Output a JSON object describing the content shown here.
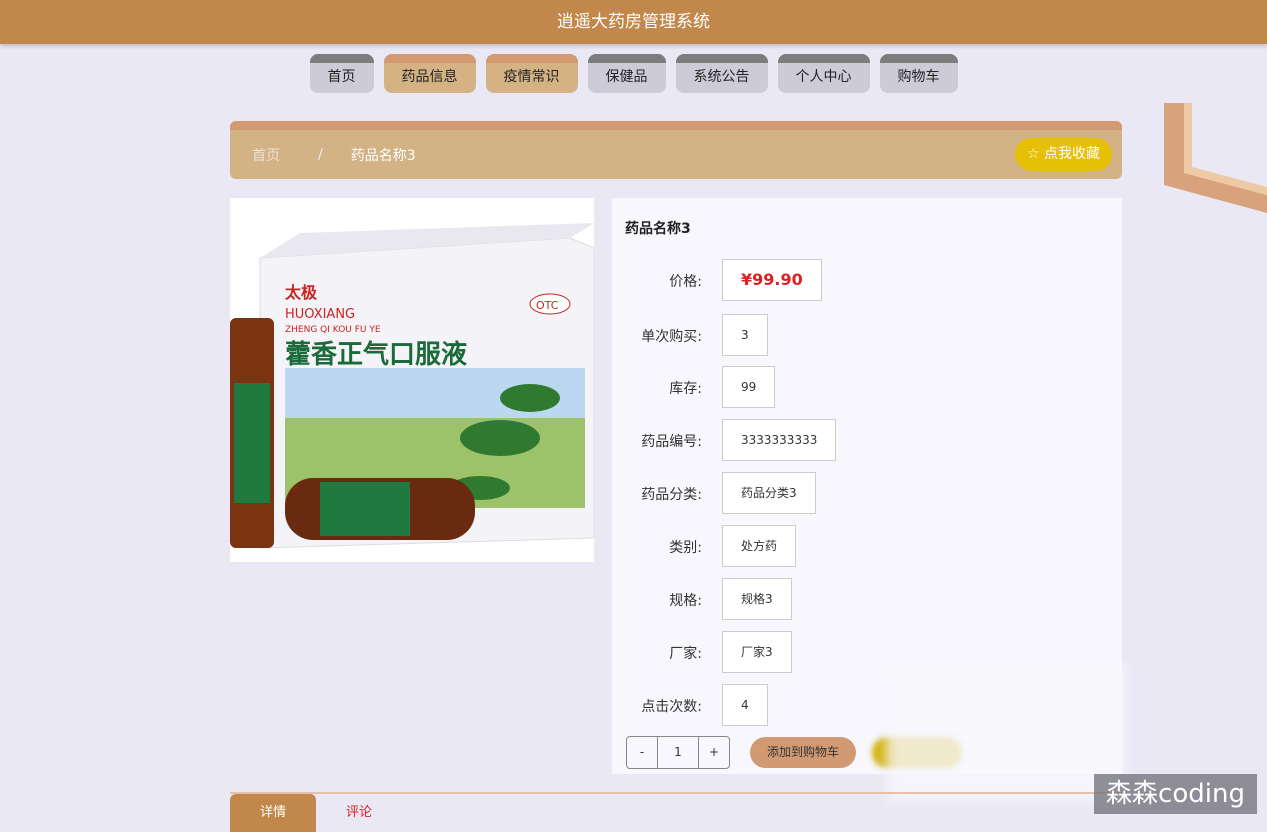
{
  "header": {
    "title": "逍遥大药房管理系统"
  },
  "nav": [
    {
      "label": "首页",
      "active": false
    },
    {
      "label": "药品信息",
      "active": true
    },
    {
      "label": "疫情常识",
      "active": true
    },
    {
      "label": "保健品",
      "active": false
    },
    {
      "label": "系统公告",
      "active": false
    },
    {
      "label": "个人中心",
      "active": false
    },
    {
      "label": "购物车",
      "active": false
    }
  ],
  "breadcrumb": {
    "home": "首页",
    "sep": "/",
    "current": "药品名称3"
  },
  "favorite_label": "☆ 点我收藏",
  "product_image": {
    "brand": "太极",
    "pinyin": "HUOXIANG",
    "pinyin2": "ZHENG QI KOU FU YE",
    "name": "藿香正气口服液",
    "badge": "OTC"
  },
  "product": {
    "title": "药品名称3",
    "fields": [
      {
        "label": "价格:",
        "value": "¥99.90"
      },
      {
        "label": "单次购买:",
        "value": "3"
      },
      {
        "label": "库存:",
        "value": "99"
      },
      {
        "label": "药品编号:",
        "value": "3333333333"
      },
      {
        "label": "药品分类:",
        "value": "药品分类3"
      },
      {
        "label": "类别:",
        "value": "处方药"
      },
      {
        "label": "规格:",
        "value": "规格3"
      },
      {
        "label": "厂家:",
        "value": "厂家3"
      },
      {
        "label": "点击次数:",
        "value": "4"
      }
    ],
    "quantity": "1",
    "minus": "-",
    "plus": "+",
    "add_to_cart": "添加到购物车"
  },
  "tabs": [
    {
      "label": "详情",
      "active": true
    },
    {
      "label": "评论",
      "active": false
    }
  ],
  "watermark": "森森coding",
  "colors": {
    "header": "#c2874a",
    "accent": "#d39a72",
    "favorite": "#e6bf07",
    "price": "#e02020"
  }
}
